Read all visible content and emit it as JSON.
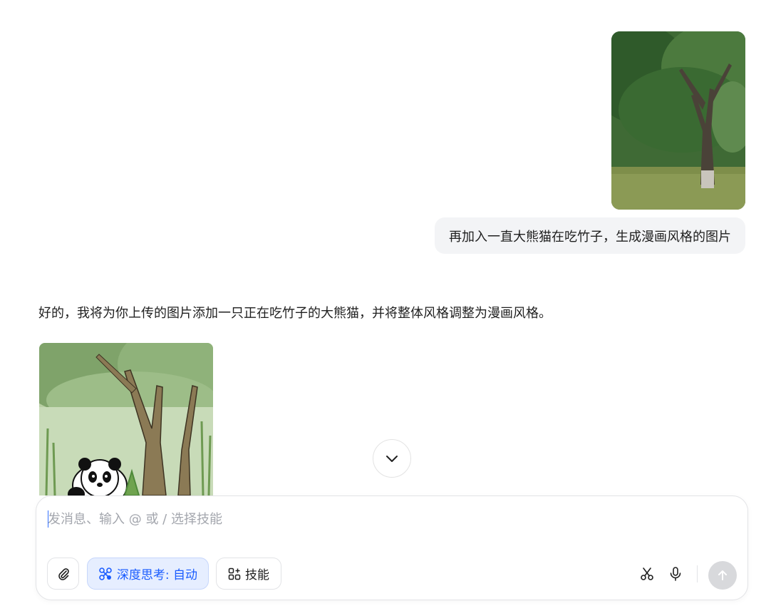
{
  "messages": {
    "user_text": "再加入一直大熊猫在吃竹子，生成漫画风格的图片",
    "assistant_text": "好的，我将为你上传的图片添加一只正在吃竹子的大熊猫，并将整体风格调整为漫画风格。"
  },
  "composer": {
    "placeholder": "发消息、输入 @ 或 / 选择技能",
    "deep_think_label": "深度思考: 自动",
    "skills_label": "技能"
  },
  "icons": {
    "attach": "paperclip-icon",
    "deep_think": "deep-think-icon",
    "skills": "apps-grid-icon",
    "scissors": "scissors-icon",
    "mic": "microphone-icon",
    "send": "arrow-up-icon",
    "scroll": "chevron-down-icon"
  },
  "colors": {
    "accent": "#1a5cff",
    "accent_bg": "#e6eeff",
    "bubble_bg": "#f3f4f6",
    "send_disabled": "#d8d9dc"
  }
}
